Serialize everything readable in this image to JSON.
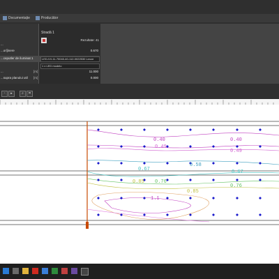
{
  "ribbon": {
    "tabs": [
      {
        "label": "Documentație"
      },
      {
        "label": "Producător"
      }
    ]
  },
  "object_panel": {
    "title": "Stradă 1",
    "results_label": "Rezultate: 41"
  },
  "properties": [
    {
      "label": "...",
      "unit": "",
      "value": ""
    },
    {
      "label": "...oriĵinere",
      "unit": "",
      "value": "0.670"
    },
    {
      "label": "...ceputler de iluminat 1",
      "unit": "",
      "field": "LED-IVI-11-70040-40-112-0022530 Lenze"
    },
    {
      "label": "",
      "unit": "",
      "field": "1 x LED modelo"
    },
    {
      "label": "...",
      "unit": "[m]",
      "value": "11.000"
    },
    {
      "label": "...supra planului util",
      "unit": "[m]",
      "value": "0.000"
    }
  ],
  "drawing": {
    "isolux_labels": [
      "0.40",
      "0.40",
      "0.49",
      "0.49",
      "0.58",
      "0.67",
      "0.67",
      "0.76",
      "0.76",
      "0.85",
      "0.85",
      "1.1"
    ]
  },
  "colors": {
    "dark_bg": "#2f2f2f",
    "panel_bg": "#3c3c3c",
    "canvas_bg": "#ffffff",
    "luminaire_marker": "#1a1acc",
    "accent_line": "#c84a00"
  },
  "icons": [
    "window-icon",
    "play-icon",
    "zoom-icon",
    "grid-icon",
    "start-icon",
    "search-icon",
    "folder-icon",
    "acrobat-icon",
    "app-icon"
  ]
}
